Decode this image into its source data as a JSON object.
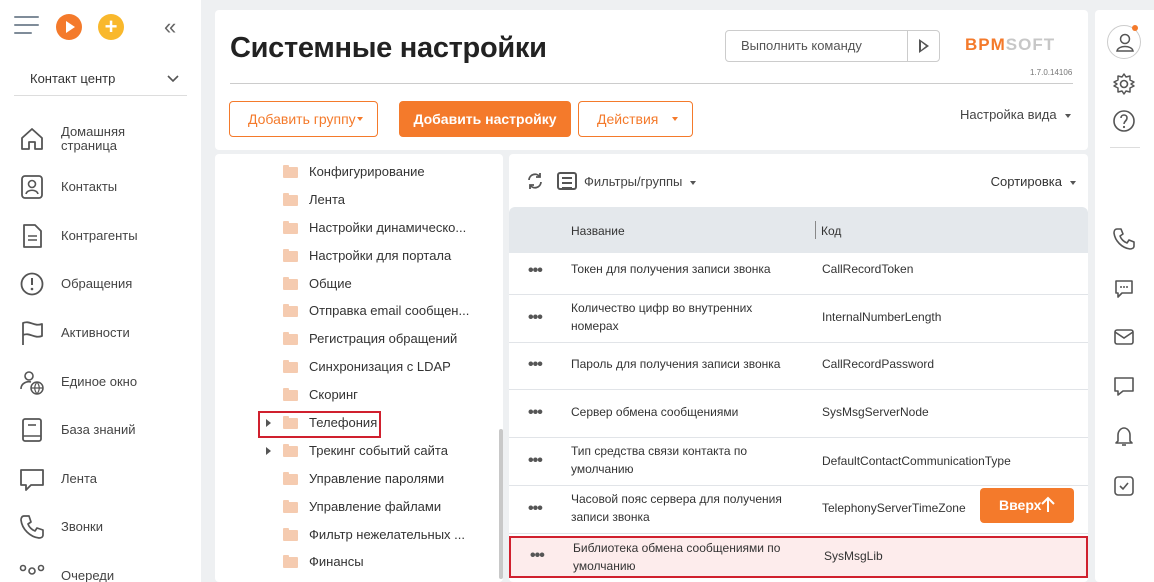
{
  "page": {
    "title": "Системные настройки",
    "version": "1.7.0.14106",
    "logo": {
      "part1": "BPM",
      "part2": "SOFT"
    }
  },
  "sidebar": {
    "workplace": "Контакт центр",
    "items": [
      {
        "label": "Домашняя страница",
        "icon": "home-icon"
      },
      {
        "label": "Контакты",
        "icon": "contact-icon"
      },
      {
        "label": "Контрагенты",
        "icon": "document-icon"
      },
      {
        "label": "Обращения",
        "icon": "alert-icon"
      },
      {
        "label": "Активности",
        "icon": "flag-icon"
      },
      {
        "label": "Единое окно",
        "icon": "user-globe-icon"
      },
      {
        "label": "База знаний",
        "icon": "book-icon"
      },
      {
        "label": "Лента",
        "icon": "chat-icon"
      },
      {
        "label": "Звонки",
        "icon": "phone-icon"
      },
      {
        "label": "Очереди",
        "icon": "queue-icon"
      }
    ]
  },
  "toolbar": {
    "command_placeholder": "Выполнить команду",
    "add_group": "Добавить группу",
    "add_setting": "Добавить настройку",
    "actions": "Действия",
    "view_settings": "Настройка вида"
  },
  "tree": {
    "items": [
      {
        "label": "Конфигурирование",
        "expandable": false
      },
      {
        "label": "Лента",
        "expandable": false
      },
      {
        "label": "Настройки динамическо...",
        "expandable": false
      },
      {
        "label": "Настройки для портала",
        "expandable": false
      },
      {
        "label": "Общие",
        "expandable": false
      },
      {
        "label": "Отправка email сообщен...",
        "expandable": false
      },
      {
        "label": "Регистрация обращений",
        "expandable": false
      },
      {
        "label": "Синхронизация с LDAP",
        "expandable": false
      },
      {
        "label": "Скоринг",
        "expandable": false
      },
      {
        "label": "Телефония",
        "expandable": true
      },
      {
        "label": "Трекинг событий сайта",
        "expandable": true
      },
      {
        "label": "Управление паролями",
        "expandable": false
      },
      {
        "label": "Управление файлами",
        "expandable": false
      },
      {
        "label": "Фильтр нежелательных ...",
        "expandable": false
      },
      {
        "label": "Финансы",
        "expandable": false
      }
    ]
  },
  "grid": {
    "filters_label": "Фильтры/группы",
    "sort_label": "Сортировка",
    "col_name": "Название",
    "col_code": "Код",
    "row_menu": "•••",
    "rows": [
      {
        "name": "Токен для получения записи звонка",
        "code": "CallRecordToken"
      },
      {
        "name": "Количество цифр во внутренних номерах",
        "code": "InternalNumberLength"
      },
      {
        "name": "Пароль для получения записи звонка",
        "code": "CallRecordPassword"
      },
      {
        "name": "Сервер обмена сообщениями",
        "code": "SysMsgServerNode"
      },
      {
        "name": "Тип средства связи контакта по умолчанию",
        "code": "DefaultContactCommunicationType"
      },
      {
        "name": "Часовой пояс сервера для получения записи звонка",
        "code": "TelephonyServerTimeZone"
      },
      {
        "name": "Библиотека обмена сообщениями по умолчанию",
        "code": "SysMsgLib"
      }
    ]
  },
  "up_button": {
    "label": "Вверх",
    "arrow": "🡑"
  },
  "colors": {
    "accent": "#f47a2b",
    "highlight": "#d0202e",
    "header_bg": "#e4e8ec"
  }
}
